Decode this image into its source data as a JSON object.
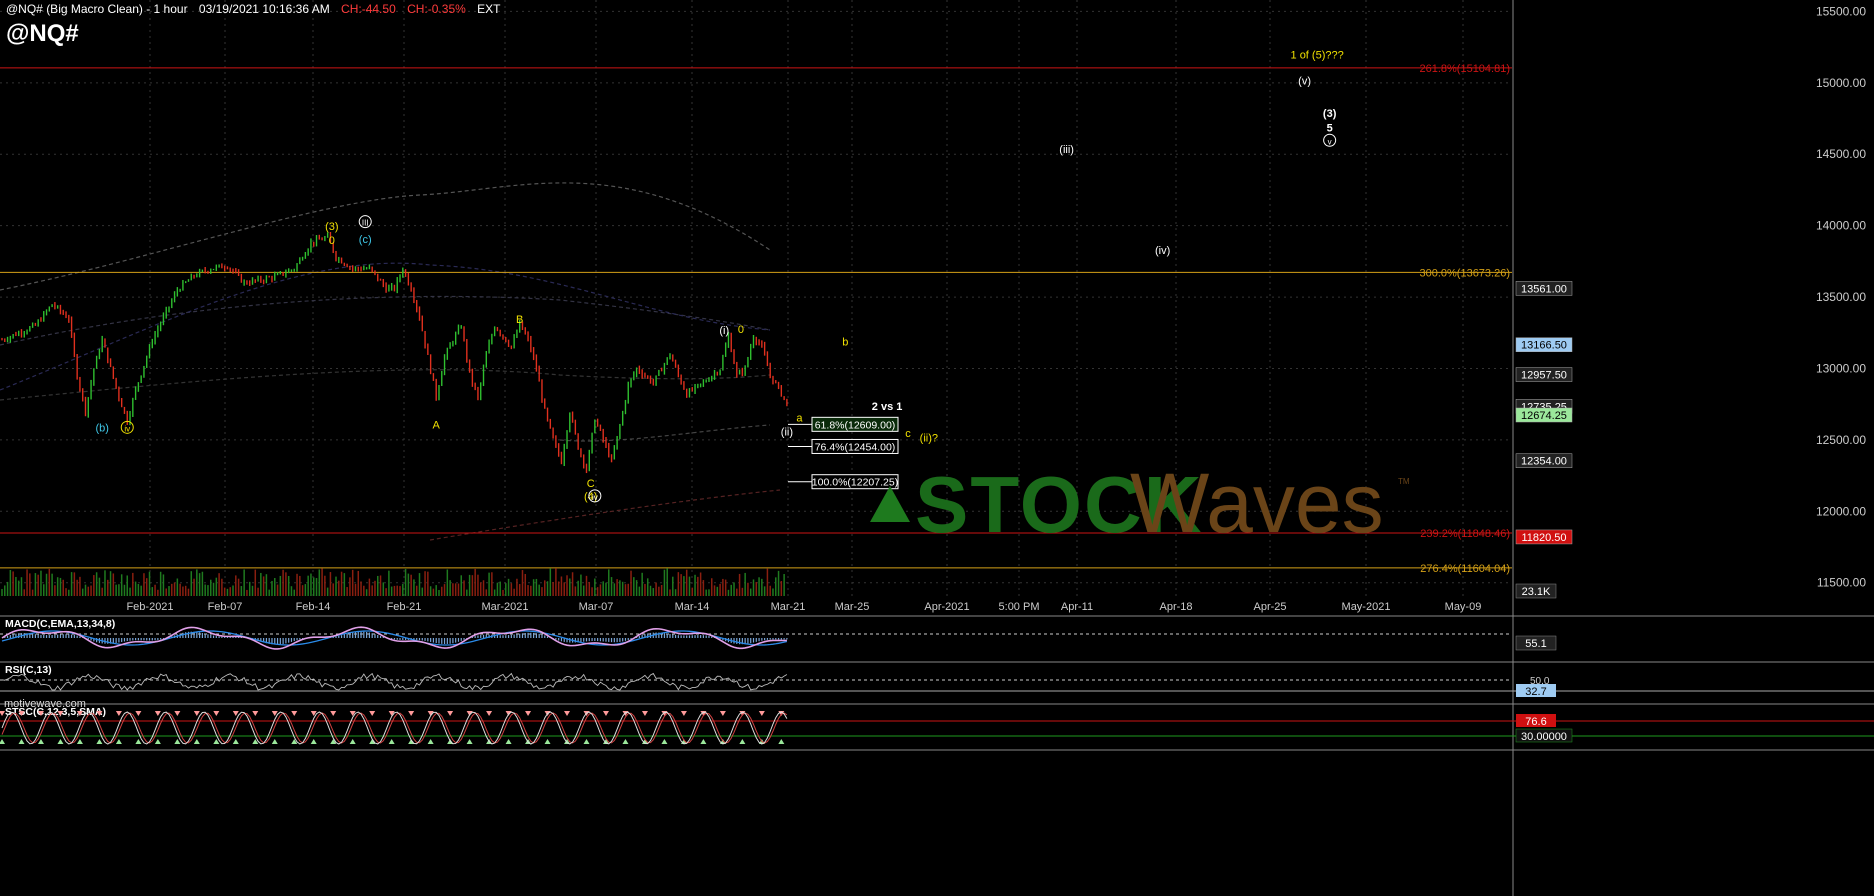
{
  "header": {
    "title": "@NQ# (Big Macro Clean) - 1 hour",
    "datetime": "03/19/2021 10:16:36 AM",
    "change": "CH:-44.50",
    "change_pct": "CH:-0.35%",
    "session": "EXT",
    "symbol": "@NQ#"
  },
  "watermark": {
    "left": "motivewave.com",
    "brand_a": "STOCK",
    "brand_b": "Waves",
    "tm": "TM"
  },
  "colors": {
    "bg": "#000000",
    "up": "#2fbf2f",
    "down": "#e0301e",
    "fib_red": "#cc1414",
    "fib_gold": "#d4a017",
    "grid": "#2a2a2a"
  },
  "chart_data": {
    "type": "line",
    "title": "@NQ# (Big Macro Clean) - 1 hour",
    "y_axis_ticks": [
      "15500.00",
      "15000.00",
      "14500.00",
      "14000.00",
      "13500.00",
      "13000.00",
      "12500.00",
      "12000.00",
      "11500.00"
    ],
    "ylim": [
      11400,
      15580
    ],
    "x_axis_ticks": [
      "Feb-2021",
      "Feb-07",
      "Feb-14",
      "Feb-21",
      "Mar-2021",
      "Mar-07",
      "Mar-14",
      "Mar-21",
      "Mar-25",
      "Apr-2021",
      "5:00 PM",
      "Apr-11",
      "Apr-18",
      "Apr-25",
      "May-2021",
      "May-09"
    ],
    "price_path": [
      [
        0,
        13200
      ],
      [
        4,
        13300
      ],
      [
        6,
        13450
      ],
      [
        7,
        13400
      ],
      [
        8,
        13350
      ],
      [
        9,
        12950
      ],
      [
        10,
        12700
      ],
      [
        11,
        13000
      ],
      [
        12,
        13200
      ],
      [
        14,
        12800
      ],
      [
        15,
        12630
      ],
      [
        16,
        12850
      ],
      [
        18,
        13200
      ],
      [
        19,
        13320
      ],
      [
        21,
        13550
      ],
      [
        23,
        13650
      ],
      [
        25,
        13700
      ],
      [
        27,
        13720
      ],
      [
        29,
        13600
      ],
      [
        31,
        13620
      ],
      [
        33,
        13650
      ],
      [
        35,
        13700
      ],
      [
        37,
        13880
      ],
      [
        39,
        13920
      ],
      [
        40,
        13780
      ],
      [
        42,
        13700
      ],
      [
        44,
        13700
      ],
      [
        46,
        13560
      ],
      [
        47,
        13560
      ],
      [
        48,
        13700
      ],
      [
        49,
        13560
      ],
      [
        50,
        13360
      ],
      [
        51,
        13080
      ],
      [
        52,
        12800
      ],
      [
        53,
        13080
      ],
      [
        54,
        13200
      ],
      [
        55,
        13300
      ],
      [
        56,
        12960
      ],
      [
        57,
        12790
      ],
      [
        58,
        13100
      ],
      [
        59,
        13300
      ],
      [
        61,
        13150
      ],
      [
        62,
        13310
      ],
      [
        63,
        13200
      ],
      [
        64,
        13000
      ],
      [
        65,
        12700
      ],
      [
        66,
        12500
      ],
      [
        67,
        12350
      ],
      [
        68,
        12700
      ],
      [
        69,
        12450
      ],
      [
        70,
        12290
      ],
      [
        71,
        12650
      ],
      [
        72,
        12500
      ],
      [
        73,
        12350
      ],
      [
        74,
        12600
      ],
      [
        75,
        12880
      ],
      [
        76,
        13000
      ],
      [
        78,
        12900
      ],
      [
        79,
        13000
      ],
      [
        80,
        13100
      ],
      [
        81,
        12950
      ],
      [
        82,
        12820
      ],
      [
        84,
        12900
      ],
      [
        86,
        13000
      ],
      [
        87,
        13230
      ],
      [
        88,
        12950
      ],
      [
        89,
        13000
      ],
      [
        90,
        13230
      ],
      [
        91,
        13150
      ],
      [
        92,
        12950
      ],
      [
        93,
        12860
      ],
      [
        94,
        12750
      ]
    ],
    "fib_levels": [
      {
        "label": "261.8%(15104.81)",
        "price": 15104.81,
        "color": "red"
      },
      {
        "label": "300.0%(13673.26)",
        "price": 13673.26,
        "color": "gold"
      },
      {
        "label": "239.2%(11848.46)",
        "price": 11848.46,
        "color": "red"
      },
      {
        "label": "276.4%(11604.04)",
        "price": 11604.04,
        "color": "gold"
      }
    ],
    "retrace_boxes": [
      {
        "label": "61.8%(12609.00)",
        "price": 12609.0
      },
      {
        "label": "76.4%(12454.00)",
        "price": 12454.0
      },
      {
        "label": "100.0%(12207.25)",
        "price": 12207.25
      }
    ],
    "price_tags": [
      {
        "label": "13561.00",
        "price": 13561,
        "kind": "plain"
      },
      {
        "label": "13166.50",
        "price": 13166.5,
        "kind": "blue"
      },
      {
        "label": "12957.50",
        "price": 12957.5,
        "kind": "plain"
      },
      {
        "label": "12735.25",
        "price": 12735.25,
        "kind": "plain"
      },
      {
        "label": "12674.25",
        "price": 12674.25,
        "kind": "green"
      },
      {
        "label": "12354.00",
        "price": 12354,
        "kind": "plain"
      },
      {
        "label": "11820.50",
        "price": 11820.5,
        "kind": "red"
      }
    ],
    "wave_labels": [
      {
        "t": "(3)",
        "c": "yellow",
        "x": 39.5,
        "p": 13970
      },
      {
        "t": "III",
        "c": "white",
        "x": 43.5,
        "p": 14000,
        "circle": true
      },
      {
        "t": "(c)",
        "c": "cyan",
        "x": 43.5,
        "p": 13880
      },
      {
        "t": "0",
        "c": "yellow",
        "x": 39.5,
        "p": 13870
      },
      {
        "t": "(b)",
        "c": "cyan",
        "x": 12,
        "p": 12560
      },
      {
        "t": "iv",
        "c": "yellow",
        "x": 15,
        "p": 12560,
        "circle": true
      },
      {
        "t": "A",
        "c": "yellow",
        "x": 52,
        "p": 12580
      },
      {
        "t": "B",
        "c": "yellow",
        "x": 62,
        "p": 13320
      },
      {
        "t": "C",
        "c": "yellow",
        "x": 70.5,
        "p": 12170
      },
      {
        "t": "(4)",
        "c": "yellow",
        "x": 70.5,
        "p": 12080
      },
      {
        "t": "iv",
        "c": "white",
        "x": 71,
        "p": 12080,
        "circle": true
      },
      {
        "t": "(i)",
        "c": "white",
        "x": 86.5,
        "p": 13240
      },
      {
        "t": "0",
        "c": "yellow",
        "x": 88.5,
        "p": 13250
      },
      {
        "t": "(ii)",
        "c": "white",
        "x": 94,
        "p": 12530
      },
      {
        "t": "a",
        "c": "yellow",
        "x": 95.5,
        "p": 12630
      },
      {
        "t": "2 vs 1",
        "c": "white",
        "x": 106,
        "p": 12710,
        "bold": true
      },
      {
        "t": "b",
        "c": "yellow",
        "x": 101,
        "p": 13160
      },
      {
        "t": "c",
        "c": "yellow",
        "x": 108.5,
        "p": 12520
      },
      {
        "t": "(ii)?",
        "c": "yellow",
        "x": 111,
        "p": 12490
      },
      {
        "t": "(iii)",
        "c": "white",
        "x": 127.5,
        "p": 14510
      },
      {
        "t": "(iv)",
        "c": "white",
        "x": 139,
        "p": 13800
      },
      {
        "t": "(v)",
        "c": "white",
        "x": 156,
        "p": 14990
      },
      {
        "t": "1 of (5)???",
        "c": "yellow",
        "x": 157.5,
        "p": 15170
      },
      {
        "t": "(3)",
        "c": "white",
        "x": 159,
        "p": 14760,
        "bold": true
      },
      {
        "t": "5",
        "c": "white",
        "x": 159,
        "p": 14660,
        "bold": true
      },
      {
        "t": "v",
        "c": "white",
        "x": 159,
        "p": 14570,
        "circle": true
      }
    ],
    "indicators": [
      {
        "name": "MACD(C,EMA,13,34,8)",
        "value": "55.1"
      },
      {
        "name": "RSI(C,13)",
        "tick": "50.0",
        "value": "32.7"
      },
      {
        "name": "STSC(C,12,3,5,SMA)",
        "value": "76.6",
        "tick": "30.00000"
      }
    ],
    "volume_tag": "23.1K"
  }
}
